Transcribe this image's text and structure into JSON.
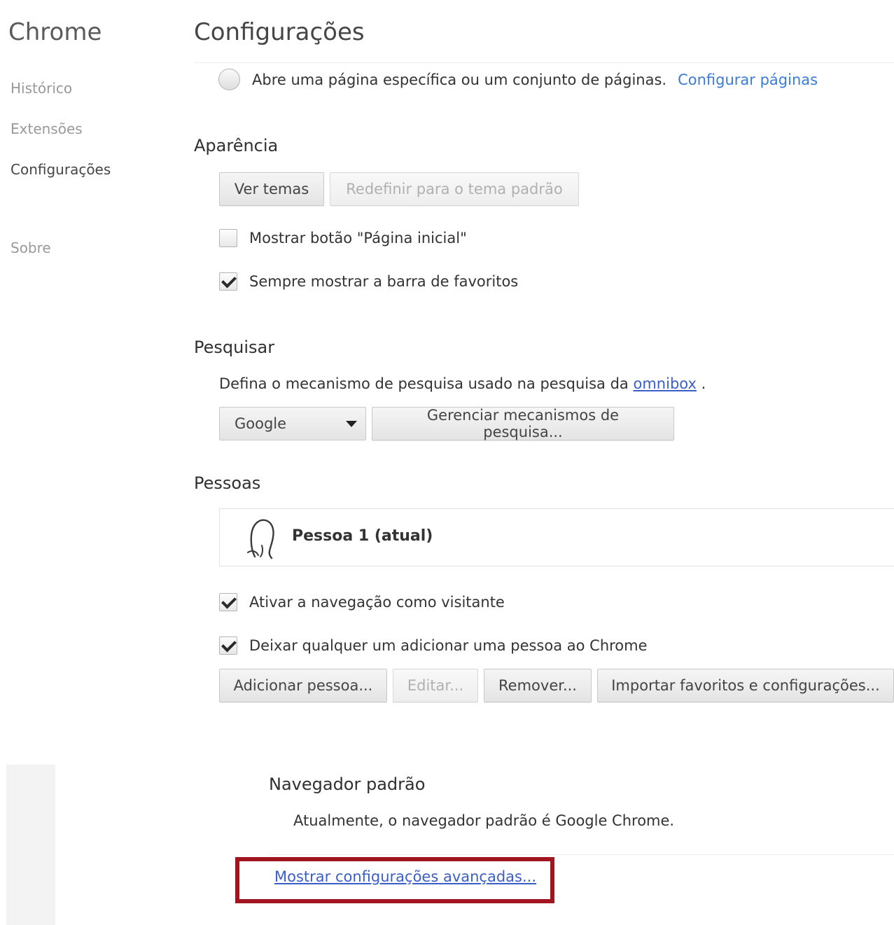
{
  "sidebar": {
    "brand": "Chrome",
    "items": [
      {
        "label": "Histórico"
      },
      {
        "label": "Extensões"
      },
      {
        "label": "Configurações"
      },
      {
        "label": "Sobre"
      }
    ]
  },
  "header": {
    "title": "Configurações"
  },
  "startup": {
    "radio_label": "Abre uma página específica ou um conjunto de páginas.",
    "link": "Configurar páginas"
  },
  "appearance": {
    "title": "Aparência",
    "themes_button": "Ver temas",
    "reset_button": "Redefinir para o tema padrão",
    "home_checkbox": {
      "label": "Mostrar botão \"Página inicial\"",
      "checked": false
    },
    "bookmarks_checkbox": {
      "label": "Sempre mostrar a barra de favoritos",
      "checked": true
    }
  },
  "search": {
    "title": "Pesquisar",
    "desc_prefix": "Defina o mecanismo de pesquisa usado na pesquisa da",
    "desc_link": "omnibox",
    "desc_suffix": ".",
    "engine_selected": "Google",
    "manage_button": "Gerenciar mecanismos de pesquisa..."
  },
  "people": {
    "title": "Pessoas",
    "current_person": "Pessoa 1 (atual)",
    "guest_checkbox": {
      "label": "Ativar a navegação como visitante",
      "checked": true
    },
    "add_anyone_checkbox": {
      "label": "Deixar qualquer um adicionar uma pessoa ao Chrome",
      "checked": true
    },
    "add_button": "Adicionar pessoa...",
    "edit_button": "Editar...",
    "remove_button": "Remover...",
    "import_button": "Importar favoritos e configurações..."
  },
  "default_browser": {
    "title": "Navegador padrão",
    "desc": "Atualmente, o navegador padrão é Google Chrome."
  },
  "advanced": {
    "link": "Mostrar configurações avançadas..."
  },
  "colors": {
    "link_blue": "#3b7bd5",
    "highlight_red": "#a01520"
  },
  "icons": {
    "avatar": "person-silhouette-icon",
    "checkmark": "checkmark-icon",
    "dropdown": "caret-down-icon"
  }
}
